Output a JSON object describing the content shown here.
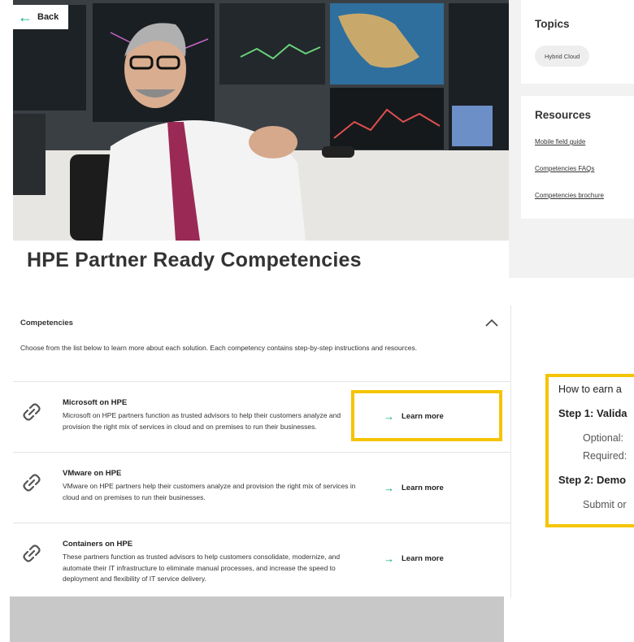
{
  "back_label": "Back",
  "page_title": "HPE Partner Ready Competencies",
  "topics": {
    "title": "Topics",
    "chips": [
      "Hybrid Cloud"
    ]
  },
  "resources": {
    "title": "Resources",
    "links": [
      "Mobile field guide",
      "Competencies FAQs",
      "Competencies brochure"
    ]
  },
  "competencies": {
    "title": "Competencies",
    "description": "Choose from the list below to learn more about each solution. Each competency contains step-by-step instructions and resources.",
    "learn_more_label": "Learn more",
    "items": [
      {
        "title": "Microsoft on HPE",
        "text": "Microsoft on HPE partners function as trusted advisors to help their customers analyze and provision the right mix of services in cloud and on premises to run their businesses."
      },
      {
        "title": "VMware on HPE",
        "text": "VMware on HPE partners help their customers analyze and provision the right mix of services in cloud and on premises to run their businesses."
      },
      {
        "title": "Containers on HPE",
        "text": "These partners function as trusted advisors to help customers consolidate, modernize, and automate their IT infrastructure to eliminate manual processes, and increase the speed to deployment and flexibility of IT service delivery."
      }
    ]
  },
  "how_to_earn": {
    "heading": "How to earn a",
    "step1": "Step 1: Valida",
    "optional": "Optional:",
    "required": "Required:",
    "step2": "Step 2: Demo",
    "submit": "Submit or"
  },
  "colors": {
    "accent_green": "#01a982",
    "highlight_yellow": "#f5c400"
  }
}
